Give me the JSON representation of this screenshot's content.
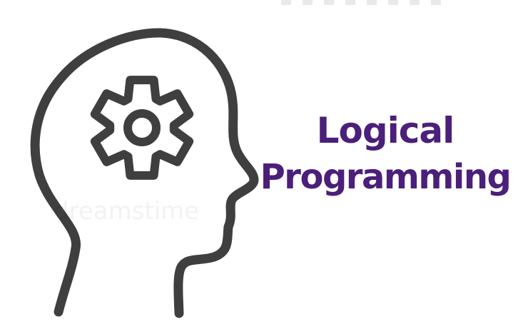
{
  "illustration": {
    "title_line_1": "Logical",
    "title_line_2": "Programming",
    "watermark": "dreamstime"
  },
  "colors": {
    "outline": "#3f3f3f",
    "title": "#4b1f7a",
    "background": "#ffffff"
  },
  "icons": [
    "head-profile-icon",
    "gear-icon"
  ]
}
